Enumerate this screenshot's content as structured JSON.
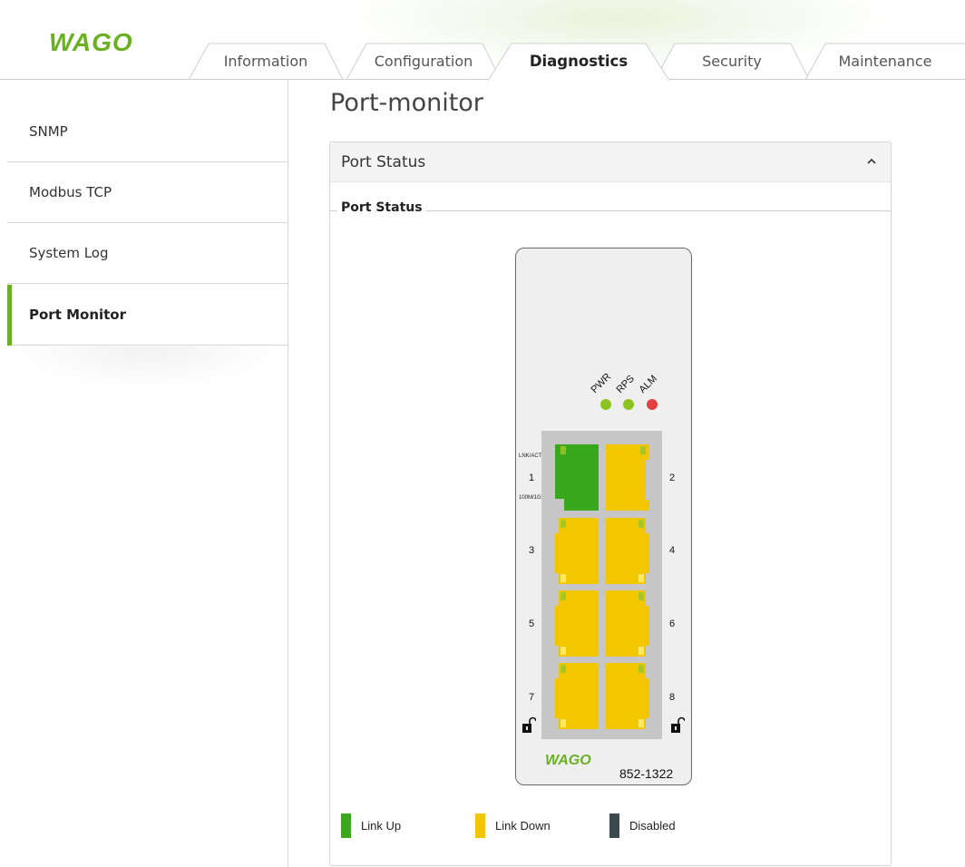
{
  "brand": {
    "logo_text": "WAGO",
    "accent": "#6ab023"
  },
  "tabs": [
    {
      "label": "Information",
      "active": false
    },
    {
      "label": "Configuration",
      "active": false
    },
    {
      "label": "Diagnostics",
      "active": true
    },
    {
      "label": "Security",
      "active": false
    },
    {
      "label": "Maintenance",
      "active": false
    }
  ],
  "sidebar": {
    "items": [
      {
        "label": "SNMP",
        "active": false
      },
      {
        "label": "Modbus TCP",
        "active": false
      },
      {
        "label": "System Log",
        "active": false
      },
      {
        "label": "Port Monitor",
        "active": true
      }
    ]
  },
  "page": {
    "title": "Port-monitor"
  },
  "panel": {
    "header": "Port Status",
    "legend": "Port Status",
    "collapse_icon": "chevron-up-icon"
  },
  "device": {
    "leds": [
      {
        "label": "PWR",
        "color": "#8dc21f"
      },
      {
        "label": "RPS",
        "color": "#8dc21f"
      },
      {
        "label": "ALM",
        "color": "#e04040"
      }
    ],
    "lnk_act_label": "LNK/ACT",
    "speed_label": "100M/1G",
    "ports": [
      {
        "number": "1",
        "status": "Link Up"
      },
      {
        "number": "2",
        "status": "Link Down"
      },
      {
        "number": "3",
        "status": "Link Down"
      },
      {
        "number": "4",
        "status": "Link Down"
      },
      {
        "number": "5",
        "status": "Link Down"
      },
      {
        "number": "6",
        "status": "Link Down"
      },
      {
        "number": "7",
        "status": "Link Down"
      },
      {
        "number": "8",
        "status": "Link Down"
      }
    ],
    "logo_text": "WAGO",
    "model": "852-1322"
  },
  "legend": [
    {
      "label": "Link Up",
      "color": "#3aa81c"
    },
    {
      "label": "Link Down",
      "color": "#f2c700"
    },
    {
      "label": "Disabled",
      "color": "#3a4a4e"
    }
  ]
}
